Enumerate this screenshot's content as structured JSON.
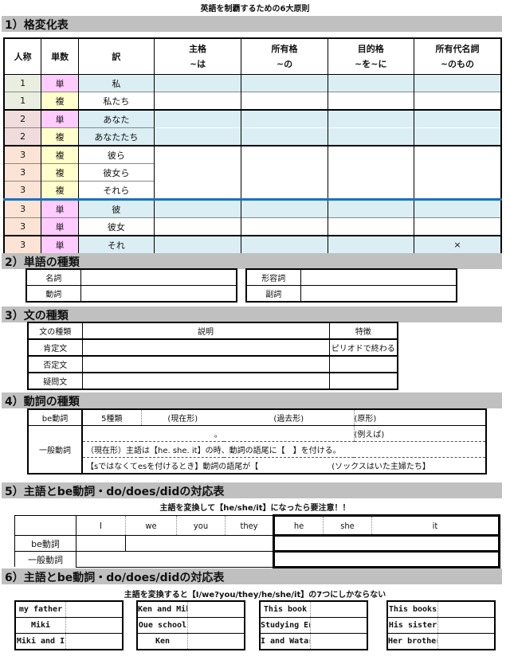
{
  "document": {
    "title": "英語を制覇するための6大原則"
  },
  "sections": [
    {
      "title": "1）格変化表"
    },
    {
      "title": "2）単語の種類"
    },
    {
      "title": "3）文の種類"
    },
    {
      "title": "4）動詞の種類"
    },
    {
      "title": "5）主語とbe動詞・do/does/didの対応表"
    },
    {
      "title": "6）主語とbe動詞・do/does/didの対応表"
    }
  ],
  "case_table": {
    "headers": [
      {
        "l1": "人称",
        "l2": ""
      },
      {
        "l1": "単数",
        "l2": ""
      },
      {
        "l1": "訳",
        "l2": ""
      },
      {
        "l1": "主格",
        "l2": "~は"
      },
      {
        "l1": "所有格",
        "l2": "~の"
      },
      {
        "l1": "目的格",
        "l2": "~を~に"
      },
      {
        "l1": "所有代名詞",
        "l2": "~のもの"
      }
    ],
    "rows": [
      {
        "person": "1",
        "number": "単",
        "meaning": "私",
        "subj": "",
        "poss": "",
        "obj": "",
        "posspron": ""
      },
      {
        "person": "1",
        "number": "複",
        "meaning": "私たち",
        "subj": "",
        "poss": "",
        "obj": "",
        "posspron": ""
      },
      {
        "person": "2",
        "number": "単",
        "meaning": "あなた",
        "subj": "",
        "poss": "",
        "obj": "",
        "posspron": ""
      },
      {
        "person": "2",
        "number": "複",
        "meaning": "あなたたち",
        "subj": "",
        "poss": "",
        "obj": "",
        "posspron": ""
      },
      {
        "person": "3",
        "number": "複",
        "meaning": "彼ら",
        "subj": "",
        "poss": "",
        "obj": "",
        "posspron": ""
      },
      {
        "person": "3",
        "number": "複",
        "meaning": "彼女ら",
        "subj": "",
        "poss": "",
        "obj": "",
        "posspron": ""
      },
      {
        "person": "3",
        "number": "複",
        "meaning": "それら",
        "subj": "",
        "poss": "",
        "obj": "",
        "posspron": ""
      },
      {
        "person": "3",
        "number": "単",
        "meaning": "彼",
        "subj": "",
        "poss": "",
        "obj": "",
        "posspron": ""
      },
      {
        "person": "3",
        "number": "単",
        "meaning": "彼女",
        "subj": "",
        "poss": "",
        "obj": "",
        "posspron": ""
      },
      {
        "person": "3",
        "number": "単",
        "meaning": "それ",
        "subj": "",
        "poss": "",
        "obj": "",
        "posspron": "×"
      }
    ]
  },
  "word_types": {
    "left": [
      {
        "label": "名詞",
        "value": ""
      },
      {
        "label": "動詞",
        "value": ""
      }
    ],
    "right": [
      {
        "label": "形容詞",
        "value": ""
      },
      {
        "label": "副詞",
        "value": ""
      }
    ]
  },
  "sentence_types": {
    "headers": [
      "文の種類",
      "説明",
      "特徴"
    ],
    "rows": [
      {
        "type": "肯定文",
        "desc": "",
        "feature": "ピリオドで終わる"
      },
      {
        "type": "否定文",
        "desc": "",
        "feature": ""
      },
      {
        "type": "疑問文",
        "desc": "",
        "feature": ""
      }
    ]
  },
  "verb_types": {
    "be_label": "be動詞",
    "be_kinds": "5種類",
    "present": "(現在形)",
    "past": "(過去形)",
    "base": "(原形)",
    "general_label": "一般動詞",
    "general_mark": "。",
    "example": "(例えば)",
    "rule1": "（現在形）主語は【he. she. it】の時、動詞の語尾に【　】を付ける。",
    "rule2": "【sではなくてesを付けるとき】動詞の語尾が【",
    "rule2_mnemonic": "(ソックスはいた主婦たち】"
  },
  "correspondence": {
    "note": "主語を変換して【he/she/it】になったら要注意！！",
    "pronouns": [
      "I",
      "we",
      "you",
      "they",
      "he",
      "she",
      "it"
    ],
    "rows": [
      "be動詞",
      "一般動詞"
    ]
  },
  "conversion": {
    "note": "主語を変換すると【I/we?you/they/he/she/it】の7つにしかならない",
    "groups": [
      [
        "my father",
        "Miki",
        "Miki and I"
      ],
      [
        "Ken and Miki",
        "Oue school",
        "Ken"
      ],
      [
        "This book",
        "Studying English",
        "I and Wataru"
      ],
      [
        "This books",
        "His sister",
        "Her brothers"
      ]
    ]
  }
}
